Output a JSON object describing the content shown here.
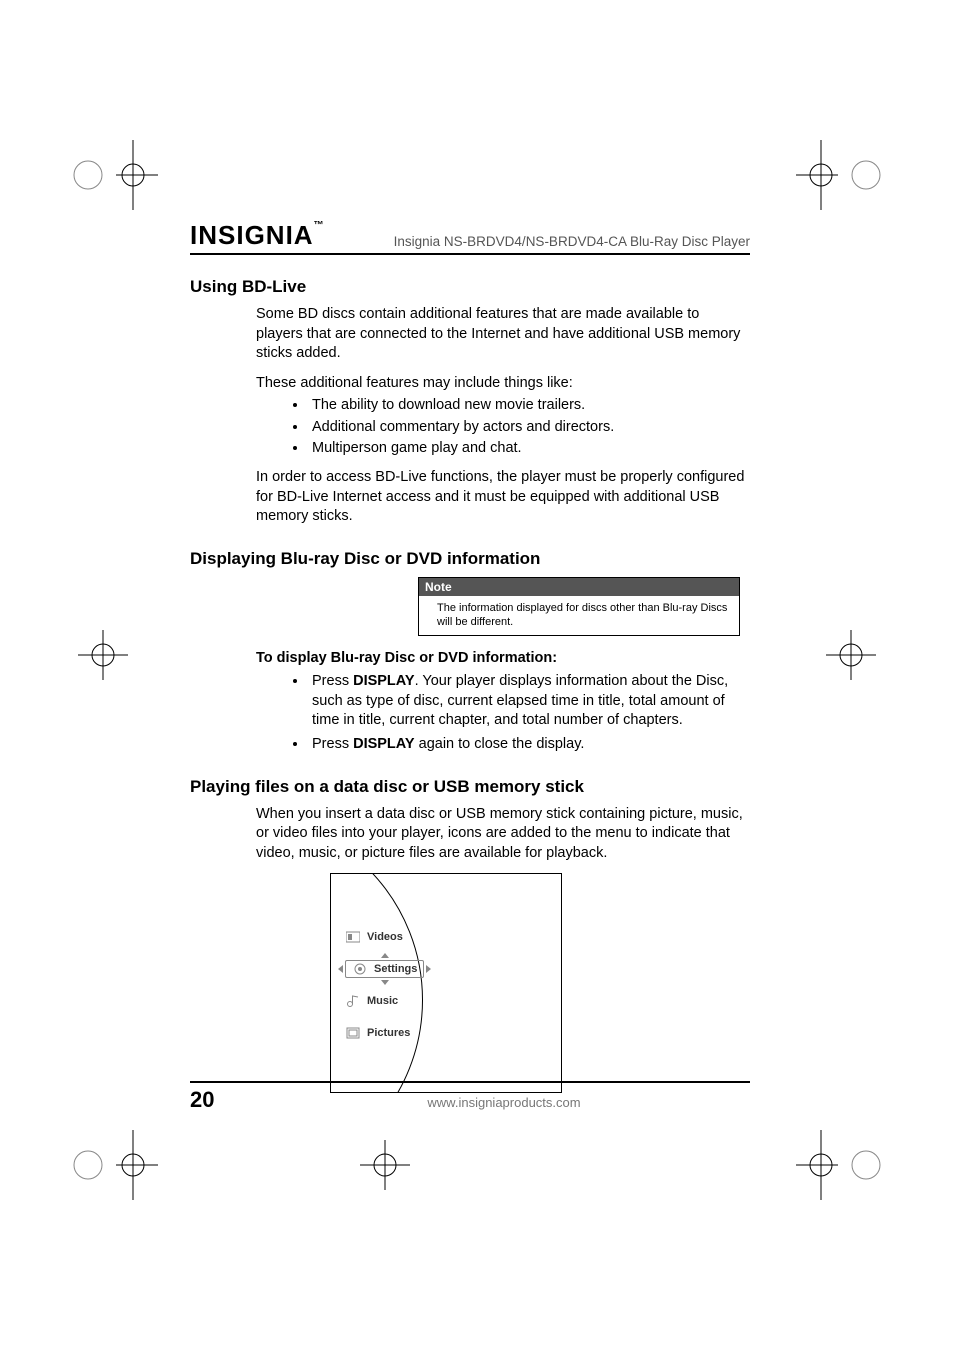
{
  "header": {
    "brand": "INSIGNIA",
    "tm": "™",
    "title": "Insignia NS-BRDVD4/NS-BRDVD4-CA Blu-Ray Disc Player"
  },
  "sections": {
    "bd_live": {
      "heading": "Using BD-Live",
      "para1": "Some BD discs contain additional features that are made available to players that are connected to the Internet and have additional USB memory sticks added.",
      "para2": "These additional features may include things like:",
      "bullets": [
        "The ability to download new movie trailers.",
        "Additional commentary by actors and directors.",
        "Multiperson game play and chat."
      ],
      "para3": "In order to access BD-Live functions, the player must be properly configured for BD-Live Internet access and it must be equipped with additional USB memory sticks."
    },
    "display_info": {
      "heading": "Displaying Blu-ray Disc or DVD information",
      "note_label": "Note",
      "note_text": "The information displayed for discs other than Blu-ray Discs will be different.",
      "sub_heading": "To display Blu-ray Disc or DVD information:",
      "steps": {
        "s1_pre": "Press ",
        "s1_b": "DISPLAY",
        "s1_post": ". Your player displays information about the Disc, such as type of disc, current elapsed time in title, total amount of time in title, current chapter, and total number of chapters.",
        "s2_pre": "Press ",
        "s2_b": "DISPLAY",
        "s2_post": " again to close the display."
      }
    },
    "playing_files": {
      "heading": "Playing files on a data disc or USB memory stick",
      "para": "When you insert a data disc or USB memory stick containing picture, music, or video files into your player, icons are added to the menu to indicate that video, music, or picture files are available for playback."
    }
  },
  "menu_screenshot": {
    "videos": "Videos",
    "settings": "Settings",
    "music": "Music",
    "pictures": "Pictures"
  },
  "footer": {
    "page": "20",
    "url": "www.insigniaproducts.com"
  }
}
